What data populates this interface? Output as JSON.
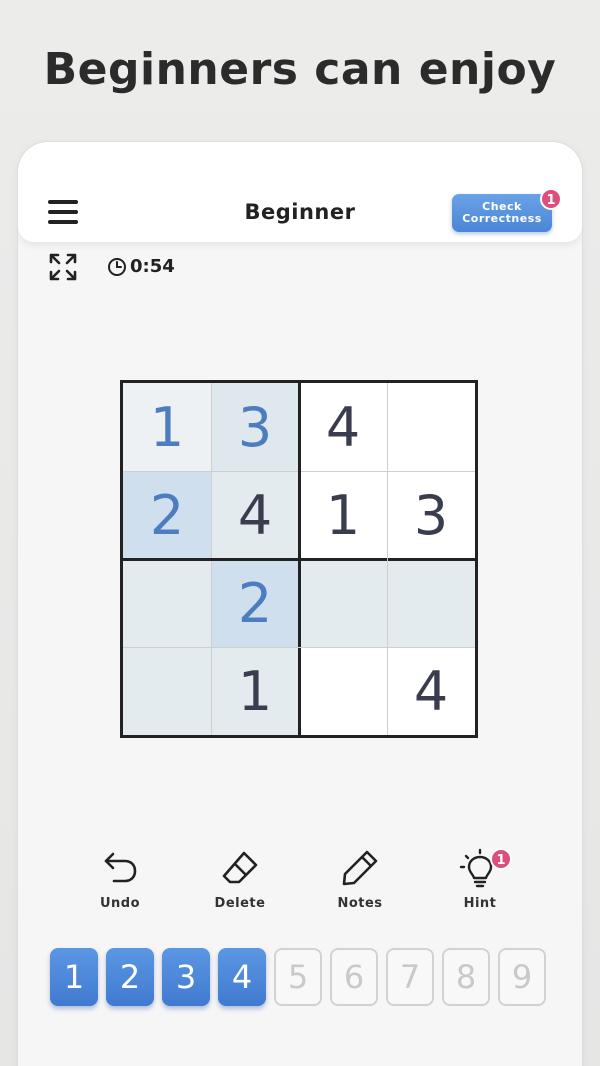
{
  "headline": "Beginners can enjoy",
  "topbar": {
    "title": "Beginner",
    "check_line1": "Check",
    "check_line2": "Correctness",
    "check_badge": "1"
  },
  "status": {
    "timer": "0:54"
  },
  "board": {
    "rows": [
      [
        {
          "v": "1",
          "user": true,
          "bg": "#edf1f3"
        },
        {
          "v": "3",
          "user": true,
          "bg": "#dfe8ec"
        },
        {
          "v": "4",
          "user": false,
          "bg": "#ffffff"
        },
        {
          "v": "",
          "user": false,
          "bg": "#ffffff"
        }
      ],
      [
        {
          "v": "2",
          "user": true,
          "bg": "#cfdfee"
        },
        {
          "v": "4",
          "user": false,
          "bg": "#e4ebee"
        },
        {
          "v": "1",
          "user": false,
          "bg": "#ffffff"
        },
        {
          "v": "3",
          "user": false,
          "bg": "#ffffff"
        }
      ],
      [
        {
          "v": "",
          "user": false,
          "bg": "#e4ebee"
        },
        {
          "v": "2",
          "user": true,
          "bg": "#cfdfee"
        },
        {
          "v": "",
          "user": false,
          "bg": "#e4ebee"
        },
        {
          "v": "",
          "user": false,
          "bg": "#e4ebee"
        }
      ],
      [
        {
          "v": "",
          "user": false,
          "bg": "#e4ebee"
        },
        {
          "v": "1",
          "user": false,
          "bg": "#e4ebee"
        },
        {
          "v": "",
          "user": false,
          "bg": "#ffffff"
        },
        {
          "v": "4",
          "user": false,
          "bg": "#ffffff"
        }
      ]
    ]
  },
  "tools": {
    "undo": "Undo",
    "delete": "Delete",
    "notes": "Notes",
    "hint": "Hint",
    "hint_badge": "1"
  },
  "numpad": {
    "keys": [
      {
        "label": "1",
        "enabled": true
      },
      {
        "label": "2",
        "enabled": true
      },
      {
        "label": "3",
        "enabled": true
      },
      {
        "label": "4",
        "enabled": true
      },
      {
        "label": "5",
        "enabled": false
      },
      {
        "label": "6",
        "enabled": false
      },
      {
        "label": "7",
        "enabled": false
      },
      {
        "label": "8",
        "enabled": false
      },
      {
        "label": "9",
        "enabled": false
      }
    ]
  },
  "colors": {
    "accent": "#4a86d6",
    "badge": "#dc4f7d",
    "user_digit": "#4d7dbf",
    "given_digit": "#3a3d4d"
  },
  "icons": {
    "menu": "menu-icon",
    "expand": "expand-icon",
    "timer": "clock-icon",
    "undo": "undo-icon",
    "delete": "eraser-icon",
    "notes": "pencil-icon",
    "hint": "lightbulb-icon"
  }
}
